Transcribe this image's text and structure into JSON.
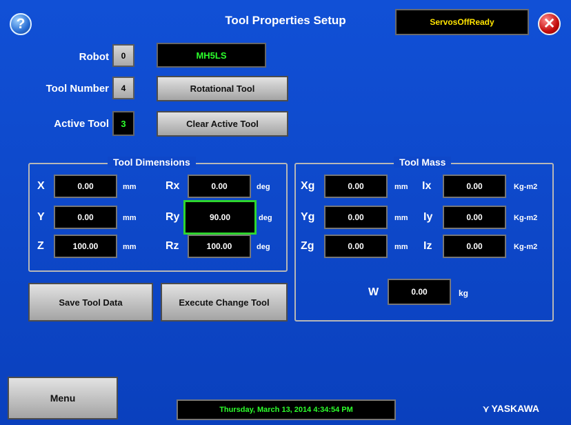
{
  "header": {
    "title": "Tool Properties Setup",
    "help_glyph": "?",
    "close_glyph": "✕",
    "status": "ServosOffReady"
  },
  "robot": {
    "label": "Robot",
    "index": "0",
    "model": "MH5LS"
  },
  "tool_number": {
    "label": "Tool Number",
    "value": "4",
    "button": "Rotational Tool"
  },
  "active_tool": {
    "label": "Active Tool",
    "value": "3",
    "button": "Clear Active Tool"
  },
  "dimensions": {
    "title": "Tool Dimensions",
    "rows": [
      {
        "axis": "X",
        "value": "0.00",
        "unit": "mm",
        "raxis": "Rx",
        "rvalue": "0.00",
        "runit": "deg"
      },
      {
        "axis": "Y",
        "value": "0.00",
        "unit": "mm",
        "raxis": "Ry",
        "rvalue": "90.00",
        "runit": "deg"
      },
      {
        "axis": "Z",
        "value": "100.00",
        "unit": "mm",
        "raxis": "Rz",
        "rvalue": "100.00",
        "runit": "deg"
      }
    ]
  },
  "mass": {
    "title": "Tool Mass",
    "rows": [
      {
        "axis": "Xg",
        "value": "0.00",
        "unit": "mm",
        "iaxis": "Ix",
        "ivalue": "0.00",
        "iunit": "Kg-m2"
      },
      {
        "axis": "Yg",
        "value": "0.00",
        "unit": "mm",
        "iaxis": "Iy",
        "ivalue": "0.00",
        "iunit": "Kg-m2"
      },
      {
        "axis": "Zg",
        "value": "0.00",
        "unit": "mm",
        "iaxis": "Iz",
        "ivalue": "0.00",
        "iunit": "Kg-m2"
      }
    ],
    "weight": {
      "label": "W",
      "value": "0.00",
      "unit": "kg"
    }
  },
  "buttons": {
    "save": "Save Tool Data",
    "execute": "Execute Change Tool",
    "menu": "Menu"
  },
  "footer": {
    "datetime": "Thursday, March 13, 2014 4:34:54 PM",
    "logo": "YASKAWA"
  },
  "colors": {
    "background": "#0d47c8",
    "value_green": "#2cff2c",
    "status_yellow": "#ffe400",
    "selection": "#2ed62e"
  }
}
